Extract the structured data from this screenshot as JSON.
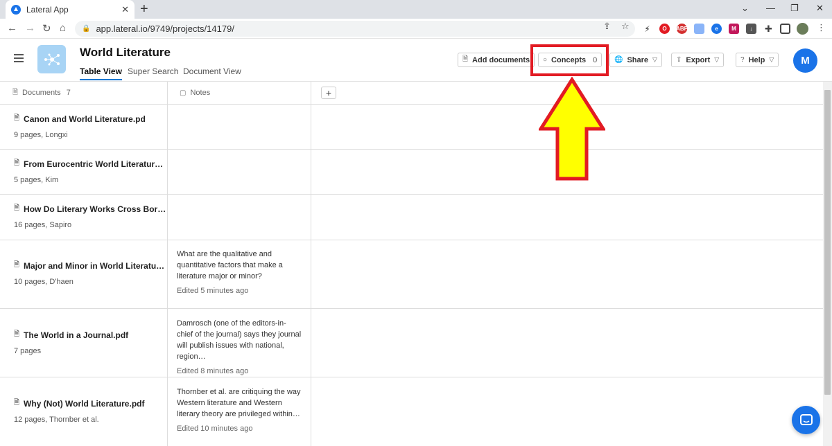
{
  "browser": {
    "tab_title": "Lateral App",
    "tab_close": "✕",
    "new_tab": "+",
    "url": "app.lateral.io/9749/projects/14179/",
    "window_controls": [
      "⌄",
      "—",
      "❐",
      "✕"
    ]
  },
  "app": {
    "project_title": "World Literature",
    "view_tabs": [
      {
        "label": "Table View",
        "active": true
      },
      {
        "label": "Super Search",
        "active": false
      },
      {
        "label": "Document View",
        "active": false
      }
    ],
    "buttons": {
      "add_documents": "Add documents",
      "concepts": "Concepts",
      "concepts_count": "0",
      "share": "Share",
      "export": "Export",
      "help": "Help"
    },
    "avatar_initial": "M"
  },
  "table": {
    "documents_header": "Documents",
    "documents_count": "7",
    "notes_header": "Notes",
    "add_column": "+",
    "rows": [
      {
        "title": "Canon and World Literature.pd",
        "meta": "9 pages, Longxi",
        "note": "",
        "edited": ""
      },
      {
        "title": "From Eurocentric World Literatur…",
        "meta": "5 pages, Kim",
        "note": "",
        "edited": ""
      },
      {
        "title": "How Do Literary Works Cross Bor…",
        "meta": "16 pages, Sapiro",
        "note": "",
        "edited": ""
      },
      {
        "title": "Major and Minor in World Literatu…",
        "meta": "10 pages, D'haen",
        "note": "What are the qualitative and quantitative factors that make a literature major or minor?",
        "edited": "Edited 5 minutes ago"
      },
      {
        "title": "The World in a Journal.pdf",
        "meta": "7 pages",
        "note": "Damrosch (one of the editors-in-chief of the journal) says they journal will publish issues with national, region…",
        "edited": "Edited 8 minutes ago"
      },
      {
        "title": "Why (Not) World Literature.pdf",
        "meta": "12 pages, Thornber et al.",
        "note": "Thornber et al. are critiquing the way Western literature and Western literary theory are privileged within…",
        "edited": "Edited 10 minutes ago"
      }
    ]
  },
  "annotation": {
    "box_color": "#e21b23",
    "arrow_fill": "#ffff00"
  }
}
